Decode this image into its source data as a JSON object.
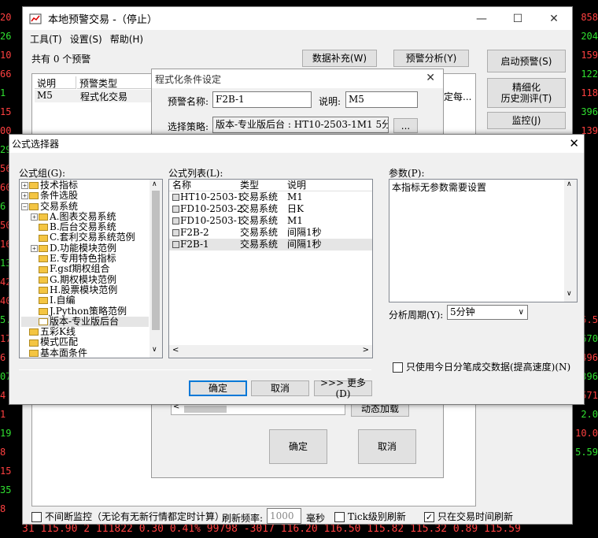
{
  "bg": {
    "left_col": [
      "20",
      "26",
      "10",
      "66",
      "1",
      "15",
      "00",
      "29",
      "56",
      "60",
      "6",
      "50",
      "16",
      "13",
      "42",
      "40",
      "5.5",
      "17",
      "6",
      "07",
      "4",
      "1",
      "19",
      "8",
      "15",
      "35",
      "8"
    ],
    "right_col": [
      "858",
      "204",
      "159",
      "122",
      "118",
      "396",
      "139",
      "",
      "",
      "",
      "",
      "",
      "",
      "",
      "",
      "",
      "5.5",
      "670",
      "496",
      "396",
      "571",
      "2.0",
      "10.0",
      "5.59"
    ],
    "bottom_row": "31  115.90     2  111822   0.30   0.41%   99798   -3017  116.20  116.50  115.82  115.32   0.89  115.59"
  },
  "main": {
    "title": "本地预警交易 -（停止）",
    "ctrl_min": "—",
    "ctrl_max": "☐",
    "ctrl_close": "✕",
    "menu": [
      "工具(T)",
      "设置(S)",
      "帮助(H)"
    ],
    "count_label": "共有 0 个预警",
    "btn_data_fill": "数据补充(W)",
    "btn_alert_analysis": "预警分析(Y)",
    "btn_start_alert": "启动预警(S)",
    "btn_refine": "精细化\n历史测评(T)",
    "btn_monitor": "监控(J)",
    "table_headers": [
      "说明",
      "预警类型"
    ],
    "table_row": {
      "desc": "M5",
      "type": "程式化交易",
      "tail": "定每..."
    },
    "bottom": {
      "continuous_label": "不间断监控（无论有无新行情都定时计算）",
      "refresh_label": "刷新频率:",
      "refresh_value": "1000",
      "ms": "毫秒",
      "tick_label": "Tick级别刷新",
      "trade_only_label": "只在交易时间刷新",
      "trade_only_checked": "✓"
    }
  },
  "sub": {
    "title": "程式化条件设定",
    "name_label": "预警名称:",
    "name_value": "F2B-1",
    "desc_label": "说明:",
    "desc_value": "M5",
    "strategy_label": "选择策略:",
    "strategy_value": "版本-专业版后台 : HT10-2503-1M1 5分 (",
    "browse": "...",
    "dynamic_load": "动态加载",
    "ok": "确定",
    "cancel": "取消"
  },
  "fs": {
    "title": "公式选择器",
    "close": "✕",
    "group_label": "公式组(G):",
    "list_label": "公式列表(L):",
    "param_label": "参数(P):",
    "param_text": "本指标无参数需要设置",
    "period_label": "分析周期(Y):",
    "period_value": "5分钟",
    "tick_only_label": "只使用今日分笔成交数据(提高速度)(N)",
    "ok": "确定",
    "cancel": "取消",
    "more": ">>> 更多(D)",
    "tree": [
      {
        "label": "技术指标",
        "pm": "+",
        "indent": 0
      },
      {
        "label": "条件选股",
        "pm": "+",
        "indent": 0
      },
      {
        "label": "交易系统",
        "pm": "−",
        "indent": 0
      },
      {
        "label": "A.图表交易系统",
        "pm": "+",
        "indent": 1
      },
      {
        "label": "B.后台交易系统",
        "pm": "",
        "indent": 1
      },
      {
        "label": "C.套利交易系统范例",
        "pm": "",
        "indent": 1
      },
      {
        "label": "D.功能模块范例",
        "pm": "+",
        "indent": 1
      },
      {
        "label": "E.专用特色指标",
        "pm": "",
        "indent": 1
      },
      {
        "label": "F.gsf期权组合",
        "pm": "",
        "indent": 1
      },
      {
        "label": "G.期权模块范例",
        "pm": "",
        "indent": 1
      },
      {
        "label": "H.股票模块范例",
        "pm": "",
        "indent": 1
      },
      {
        "label": "I.自编",
        "pm": "",
        "indent": 1
      },
      {
        "label": "J.Python策略范例",
        "pm": "",
        "indent": 1
      },
      {
        "label": "版本-专业版后台",
        "pm": "",
        "indent": 1,
        "open": true
      },
      {
        "label": "五彩K线",
        "pm": "",
        "indent": 0
      },
      {
        "label": "模式匹配",
        "pm": "",
        "indent": 0
      },
      {
        "label": "基本面条件",
        "pm": "",
        "indent": 0
      }
    ],
    "list_headers": [
      "名称",
      "类型",
      "说明"
    ],
    "list": [
      {
        "name": "HT10-2503-1",
        "type": "交易系统",
        "desc": "M1"
      },
      {
        "name": "FD10-2503-2",
        "type": "交易系统",
        "desc": "日K"
      },
      {
        "name": "FD10-2503-1",
        "type": "交易系统",
        "desc": "M1"
      },
      {
        "name": "F2B-2",
        "type": "交易系统",
        "desc": "间隔1秒"
      },
      {
        "name": "F2B-1",
        "type": "交易系统",
        "desc": "间隔1秒"
      }
    ]
  }
}
